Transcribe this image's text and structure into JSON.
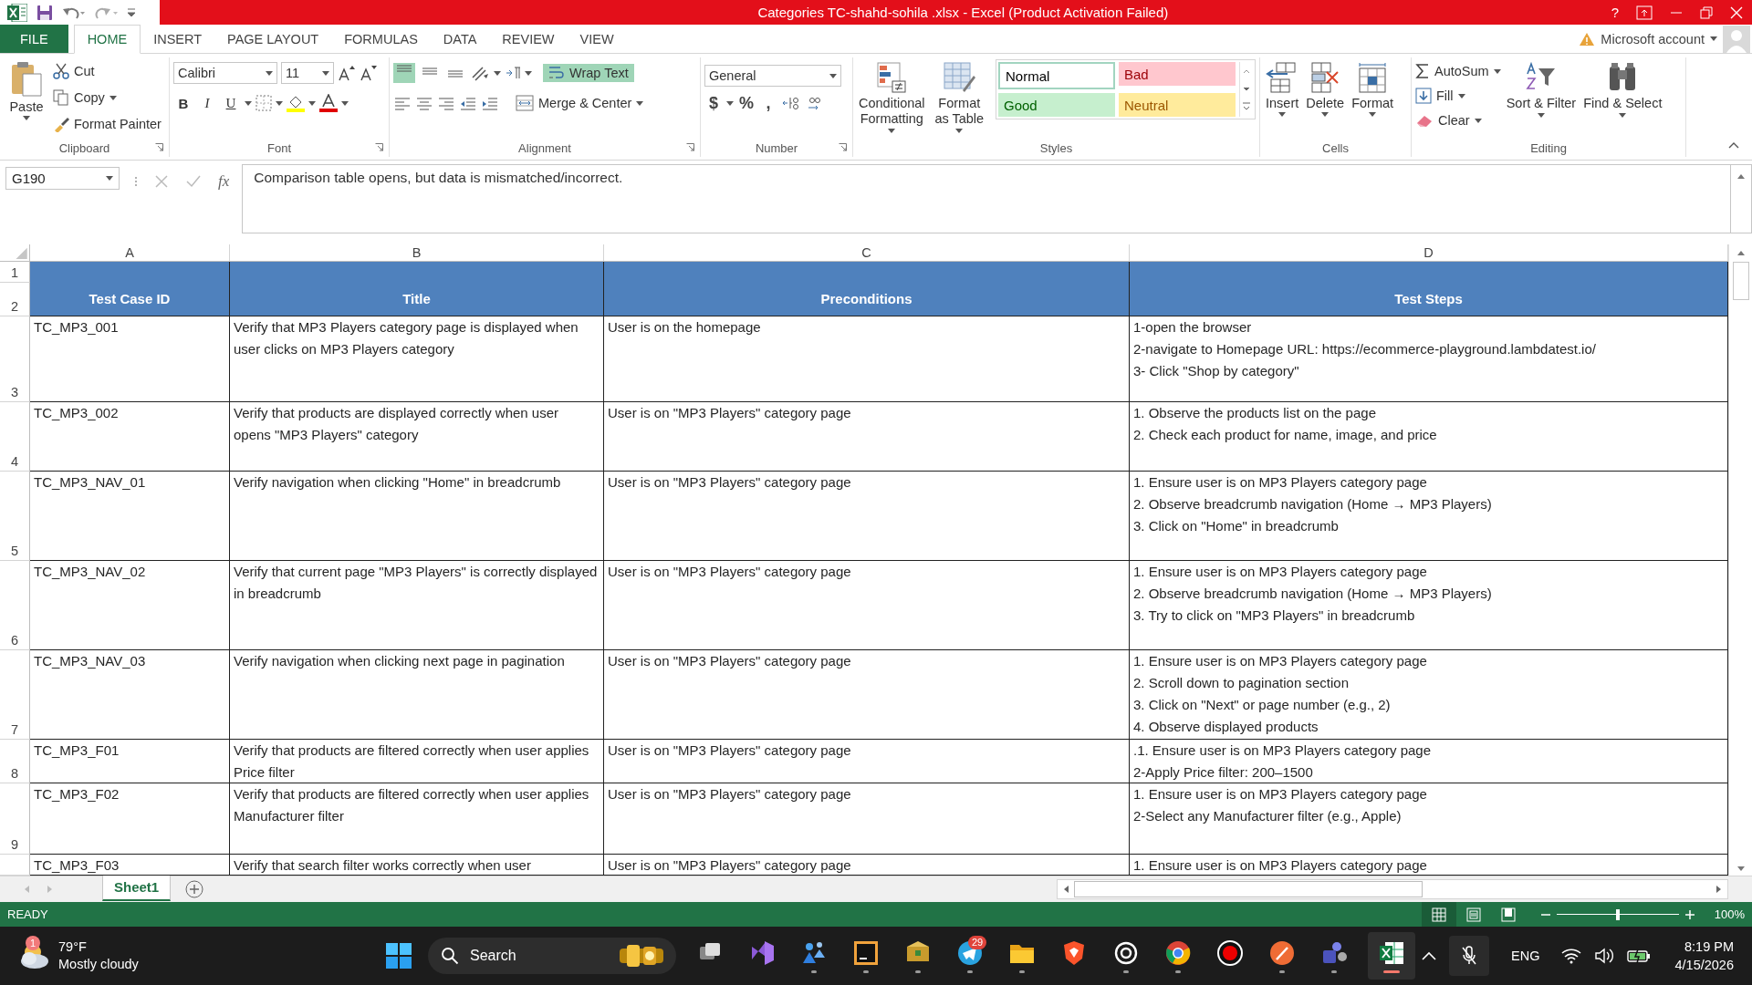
{
  "title_bar": {
    "title": "Categories TC-shahd-sohila .xlsx -  Excel (Product Activation Failed)",
    "help": "?"
  },
  "ribbon_tabs": [
    {
      "label": "FILE",
      "kind": "file",
      "selected": false
    },
    {
      "label": "HOME",
      "kind": "tab",
      "selected": true
    },
    {
      "label": "INSERT",
      "kind": "tab",
      "selected": false
    },
    {
      "label": "PAGE LAYOUT",
      "kind": "tab",
      "selected": false
    },
    {
      "label": "FORMULAS",
      "kind": "tab",
      "selected": false
    },
    {
      "label": "DATA",
      "kind": "tab",
      "selected": false
    },
    {
      "label": "REVIEW",
      "kind": "tab",
      "selected": false
    },
    {
      "label": "VIEW",
      "kind": "tab",
      "selected": false
    }
  ],
  "account": {
    "label": "Microsoft account"
  },
  "ribbon": {
    "clipboard": {
      "label": "Clipboard",
      "paste": "Paste",
      "cut": "Cut",
      "copy": "Copy",
      "format_painter": "Format Painter"
    },
    "font": {
      "label": "Font",
      "name": "Calibri",
      "size": "11",
      "bold": "B",
      "italic": "I",
      "underline": "U"
    },
    "alignment": {
      "label": "Alignment",
      "align_buttons": [
        {
          "on": true
        },
        {
          "on": false
        },
        {
          "on": false
        }
      ],
      "wrap_text": {
        "label": "Wrap Text",
        "on": true
      },
      "merge": {
        "label": "Merge & Center",
        "on": false
      }
    },
    "number": {
      "label": "Number",
      "format": "General",
      "symbols": [
        "$",
        "%",
        ","
      ]
    },
    "styles": {
      "label": "Styles",
      "conditional": "Conditional Formatting",
      "format_table": "Format as Table",
      "cell_styles": [
        {
          "label": "Normal",
          "kind": "normal"
        },
        {
          "label": "Bad",
          "kind": "bad"
        },
        {
          "label": "Good",
          "kind": "good"
        },
        {
          "label": "Neutral",
          "kind": "neutral"
        }
      ]
    },
    "cells": {
      "label": "Cells",
      "buttons": [
        "Insert",
        "Delete",
        "Format"
      ]
    },
    "editing": {
      "label": "Editing",
      "autosum": "AutoSum",
      "fill": "Fill",
      "clear": "Clear",
      "sort": "Sort & Filter",
      "find": "Find & Select"
    }
  },
  "formula_bar": {
    "name_box": "G190",
    "fx": "fx",
    "formula": "Comparison table opens, but data is mismatched/incorrect."
  },
  "sheet": {
    "columns": [
      "A",
      "B",
      "C",
      "D"
    ],
    "rows": [
      {
        "number": "1",
        "kind": "band"
      },
      {
        "number": "2",
        "kind": "header",
        "cells": [
          "Test Case ID",
          "Title",
          "Preconditions",
          "Test Steps"
        ]
      },
      {
        "number": "3",
        "kind": "data",
        "cells": [
          "TC_MP3_001",
          "Verify that MP3 Players category page is displayed when user clicks on MP3 Players category",
          "User is on the homepage",
          "1-open the browser\n2-navigate to Homepage URL: https://ecommerce-playground.lambdatest.io/\n3- Click \"Shop by category\""
        ]
      },
      {
        "number": "4",
        "kind": "data",
        "cells": [
          "TC_MP3_002",
          "Verify that products are displayed correctly when user opens \"MP3 Players\" category",
          "User is on \"MP3 Players\" category page",
          "1. Observe the products list on the page\n2. Check each product for name, image, and price"
        ]
      },
      {
        "number": "5",
        "kind": "data",
        "cells": [
          "TC_MP3_NAV_01",
          "Verify navigation when clicking \"Home\" in breadcrumb",
          "User is on \"MP3 Players\" category page",
          "1. Ensure user is on MP3 Players category page\n2. Observe breadcrumb navigation (Home → MP3 Players)\n3. Click on \"Home\" in breadcrumb"
        ]
      },
      {
        "number": "6",
        "kind": "data",
        "cells": [
          "TC_MP3_NAV_02",
          "Verify that current page \"MP3 Players\" is correctly displayed in breadcrumb",
          "User is on \"MP3 Players\" category page",
          "1. Ensure user is on MP3 Players category page\n2. Observe breadcrumb navigation (Home → MP3 Players)\n3. Try to click on \"MP3 Players\" in breadcrumb"
        ]
      },
      {
        "number": "7",
        "kind": "data",
        "cells": [
          "TC_MP3_NAV_03",
          "Verify navigation when clicking next page in pagination",
          "User is on \"MP3 Players\" category page",
          "1. Ensure user is on MP3 Players category page\n2. Scroll down to pagination section\n3. Click on \"Next\" or page number (e.g., 2)\n4. Observe displayed products"
        ]
      },
      {
        "number": "8",
        "kind": "data",
        "cells": [
          "TC_MP3_F01",
          "Verify that products are filtered correctly when user applies Price filter",
          "User is on \"MP3 Players\" category page",
          ".1. Ensure user is on MP3 Players category page\n2-Apply Price filter: 200–1500"
        ]
      },
      {
        "number": "9",
        "kind": "data",
        "cells": [
          "TC_MP3_F02",
          "Verify that products are filtered correctly when user applies Manufacturer filter",
          "User is on \"MP3 Players\" category page",
          "1. Ensure user is on MP3 Players category page\n2-Select any Manufacturer filter (e.g., Apple)"
        ]
      },
      {
        "kind": "data",
        "cells": [
          "TC_MP3_F03",
          "Verify that search filter works correctly when user",
          "User is on \"MP3 Players\" category page",
          "1. Ensure user is on MP3 Players category page"
        ]
      }
    ]
  },
  "sheet_tabs": [
    {
      "label": "Sheet1",
      "selected": true
    }
  ],
  "status_bar": {
    "mode": "READY",
    "views": [
      {
        "selected": true
      },
      {
        "selected": false
      },
      {
        "selected": false
      }
    ],
    "zoom": {
      "level": 0.5,
      "reading": "100%"
    }
  },
  "taskbar": {
    "weather": {
      "badge": "1",
      "temperature": "79°F",
      "condition": "Mostly cloudy"
    },
    "search": {
      "label": "Search"
    },
    "apps": [
      {
        "running": false,
        "active": false
      },
      {
        "running": false,
        "active": false
      },
      {
        "running": true,
        "active": false
      },
      {
        "running": true,
        "active": false
      },
      {
        "running": true,
        "active": false
      },
      {
        "running": true,
        "active": false,
        "badge": "29"
      },
      {
        "running": true,
        "active": false
      },
      {
        "running": false,
        "active": false
      },
      {
        "running": true,
        "active": false
      },
      {
        "running": true,
        "active": false
      },
      {
        "running": false,
        "active": false
      },
      {
        "running": true,
        "active": false
      },
      {
        "running": true,
        "active": false
      },
      {
        "running": true,
        "active": true
      }
    ],
    "language": "ENG",
    "time": "8:19 PM",
    "date": "4/15/2026"
  }
}
